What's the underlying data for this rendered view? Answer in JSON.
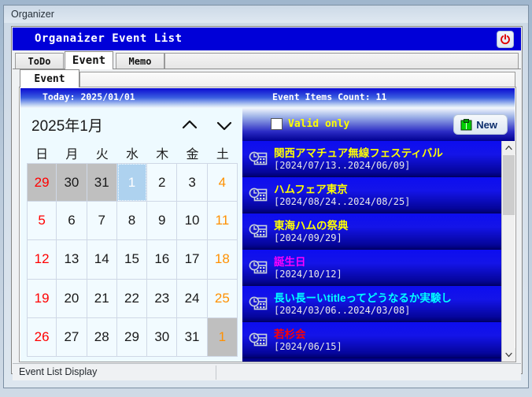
{
  "window": {
    "title": "Organizer"
  },
  "app": {
    "header_title": "Organaizer Event List",
    "power_icon": "power-icon"
  },
  "outer_tabs": [
    {
      "label": "ToDo",
      "selected": false
    },
    {
      "label": "Event",
      "selected": true
    },
    {
      "label": "Memo",
      "selected": false
    }
  ],
  "inner_tabs": [
    {
      "label": "Event",
      "selected": true
    }
  ],
  "info": {
    "today": "Today: 2025/01/01",
    "count": "Event Items Count: 11"
  },
  "calendar": {
    "month_label": "2025年1月",
    "prev_icon": "chevron-up-icon",
    "next_icon": "chevron-down-icon",
    "weekdays": [
      "日",
      "月",
      "火",
      "水",
      "木",
      "金",
      "土"
    ],
    "weeks": [
      [
        {
          "d": "29",
          "type": "other",
          "tone": "sun"
        },
        {
          "d": "30",
          "type": "other",
          "tone": "normal"
        },
        {
          "d": "31",
          "type": "other",
          "tone": "normal"
        },
        {
          "d": "1",
          "type": "today",
          "tone": "normal"
        },
        {
          "d": "2",
          "type": "cur",
          "tone": "normal"
        },
        {
          "d": "3",
          "type": "cur",
          "tone": "normal"
        },
        {
          "d": "4",
          "type": "cur",
          "tone": "sat"
        }
      ],
      [
        {
          "d": "5",
          "type": "cur",
          "tone": "sun"
        },
        {
          "d": "6",
          "type": "cur",
          "tone": "normal"
        },
        {
          "d": "7",
          "type": "cur",
          "tone": "normal"
        },
        {
          "d": "8",
          "type": "cur",
          "tone": "normal"
        },
        {
          "d": "9",
          "type": "cur",
          "tone": "normal"
        },
        {
          "d": "10",
          "type": "cur",
          "tone": "normal"
        },
        {
          "d": "11",
          "type": "cur",
          "tone": "sat"
        }
      ],
      [
        {
          "d": "12",
          "type": "cur",
          "tone": "sun"
        },
        {
          "d": "13",
          "type": "cur",
          "tone": "normal"
        },
        {
          "d": "14",
          "type": "cur",
          "tone": "normal"
        },
        {
          "d": "15",
          "type": "cur",
          "tone": "normal"
        },
        {
          "d": "16",
          "type": "cur",
          "tone": "normal"
        },
        {
          "d": "17",
          "type": "cur",
          "tone": "normal"
        },
        {
          "d": "18",
          "type": "cur",
          "tone": "sat"
        }
      ],
      [
        {
          "d": "19",
          "type": "cur",
          "tone": "sun"
        },
        {
          "d": "20",
          "type": "cur",
          "tone": "normal"
        },
        {
          "d": "21",
          "type": "cur",
          "tone": "normal"
        },
        {
          "d": "22",
          "type": "cur",
          "tone": "normal"
        },
        {
          "d": "23",
          "type": "cur",
          "tone": "normal"
        },
        {
          "d": "24",
          "type": "cur",
          "tone": "normal"
        },
        {
          "d": "25",
          "type": "cur",
          "tone": "sat"
        }
      ],
      [
        {
          "d": "26",
          "type": "cur",
          "tone": "sun"
        },
        {
          "d": "27",
          "type": "cur",
          "tone": "normal"
        },
        {
          "d": "28",
          "type": "cur",
          "tone": "normal"
        },
        {
          "d": "29",
          "type": "cur",
          "tone": "normal"
        },
        {
          "d": "30",
          "type": "cur",
          "tone": "normal"
        },
        {
          "d": "31",
          "type": "cur",
          "tone": "normal"
        },
        {
          "d": "1",
          "type": "other",
          "tone": "sat"
        }
      ]
    ]
  },
  "event_panel": {
    "valid_only_label": "Valid only",
    "valid_only_checked": false,
    "new_button_label": "New",
    "new_button_icon": "new-event-icon",
    "scroll_up_icon": "scroll-up-icon",
    "scroll_down_icon": "scroll-down-icon",
    "row_icon": "event-clock-calendar-icon",
    "items": [
      {
        "title": "関西アマチュア無線フェスティバル",
        "date": "[2024/07/13..2024/06/09]",
        "color": "#ffff00"
      },
      {
        "title": "ハムフェア東京",
        "date": "[2024/08/24..2024/08/25]",
        "color": "#ffff00"
      },
      {
        "title": "東海ハムの祭典",
        "date": "[2024/09/29]",
        "color": "#ffff00"
      },
      {
        "title": "誕生日",
        "date": "[2024/10/12]",
        "color": "#ff00ff"
      },
      {
        "title": "長い長ーいtitleってどうなるか実験し",
        "date": "[2024/03/06..2024/03/08]",
        "color": "#00ffff"
      },
      {
        "title": "若杉会",
        "date": "[2024/06/15]",
        "color": "#ff0000"
      }
    ]
  },
  "statusbar": {
    "text": "Event List Display"
  }
}
